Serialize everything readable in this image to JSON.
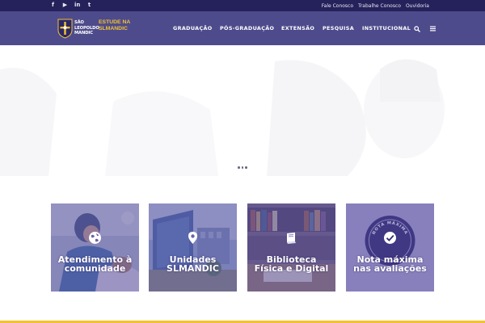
{
  "topbar": {
    "social": [
      {
        "icon": "facebook-icon",
        "glyph": "f"
      },
      {
        "icon": "youtube-icon",
        "glyph": "▶"
      },
      {
        "icon": "linkedin-icon",
        "glyph": "in"
      },
      {
        "icon": "twitter-icon",
        "glyph": "t"
      }
    ],
    "links": [
      "Fale Conosco",
      "Trabalhe Conosco",
      "Ouvidoria"
    ]
  },
  "header": {
    "logo": {
      "name_line1": "SÃO",
      "name_line2": "LEOPOLDO",
      "name_line3": "MANDIC",
      "tag_line1": "ESTUDE NA",
      "tag_line2": "SLMANDIC"
    },
    "nav": [
      "GRADUAÇÃO",
      "PÓS-GRADUAÇÃO",
      "EXTENSÃO",
      "PESQUISA",
      "INSTITUCIONAL"
    ],
    "search_icon": "search-icon",
    "menu_icon": "hamburger-menu-icon"
  },
  "hero": {
    "slider_dots": 3
  },
  "cards": [
    {
      "title": "Atendimento à\ncomunidade",
      "icon": "globe-icon"
    },
    {
      "title": "Unidades\nSLMANDIC",
      "icon": "map-pin-icon"
    },
    {
      "title": "Biblioteca\nFísica e Digital",
      "icon": "book-icon"
    },
    {
      "title": "Nota máxima\nnas avaliações",
      "icon": "check-badge-icon",
      "badge_text": "NOTA MÁXIMA"
    }
  ],
  "colors": {
    "topbar": "#25215a",
    "header": "#4e4b8c",
    "accent": "#f2c230",
    "card_overlay": "#5c54a0"
  }
}
